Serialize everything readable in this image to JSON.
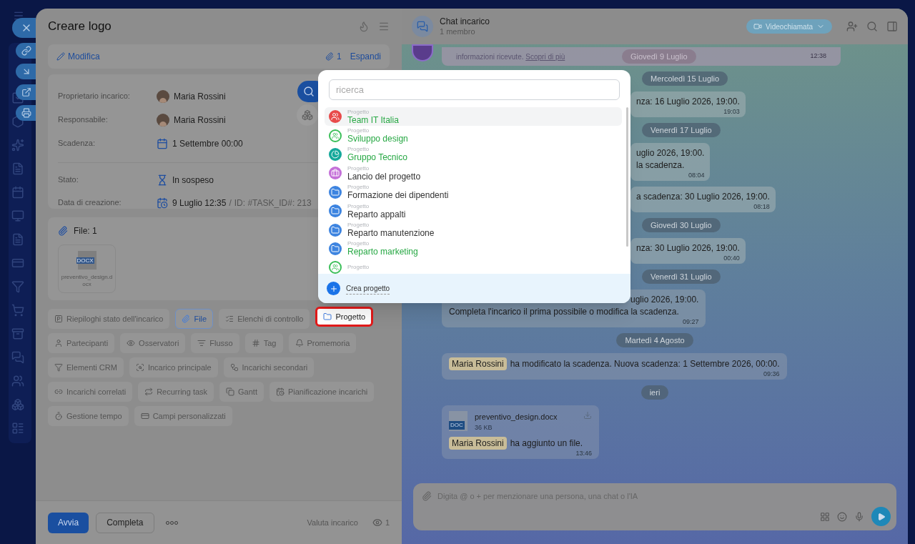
{
  "task": {
    "title": "Creare logo",
    "edit_link": "Modifica",
    "attachments_count": "1",
    "expand_link": "Espandi",
    "fields": [
      {
        "label": "Proprietario incarico:",
        "value": "Maria Rossini",
        "kind": "person"
      },
      {
        "label": "Responsabile:",
        "value": "Maria Rossini",
        "kind": "person"
      },
      {
        "label": "Scadenza:",
        "value": "1 Settembre 00:00",
        "kind": "date"
      },
      {
        "label": "Stato:",
        "value": "In sospeso",
        "kind": "status"
      },
      {
        "label": "Data di creazione:",
        "value": "9 Luglio 12:35",
        "kind": "created",
        "separator": "/",
        "id": "ID: #TASK_ID#: 213"
      }
    ],
    "files_title": "File: 1",
    "file": {
      "name": "preventivo_design.docx",
      "badge": "DOCX"
    },
    "chip_rows": [
      [
        {
          "label": "Riepiloghi stato dell'incarico",
          "selected": false,
          "highlighted": false
        },
        {
          "label": "File",
          "selected": true,
          "highlighted": false
        },
        {
          "label": "Elenchi di controllo",
          "selected": false,
          "highlighted": false
        },
        {
          "label": "Progetto",
          "selected": false,
          "highlighted": true
        }
      ],
      [
        {
          "label": "Partecipanti",
          "selected": false,
          "highlighted": false
        },
        {
          "label": "Osservatori",
          "selected": false,
          "highlighted": false
        },
        {
          "label": "Flusso",
          "selected": false,
          "highlighted": false
        },
        {
          "label": "Tag",
          "selected": false,
          "highlighted": false
        },
        {
          "label": "Promemoria",
          "selected": false,
          "highlighted": false
        }
      ],
      [
        {
          "label": "Elementi CRM",
          "selected": false,
          "highlighted": false
        },
        {
          "label": "Incarico principale",
          "selected": false,
          "highlighted": false
        },
        {
          "label": "Incarichi secondari",
          "selected": false,
          "highlighted": false
        }
      ],
      [
        {
          "label": "Incarichi correlati",
          "selected": false,
          "highlighted": false
        },
        {
          "label": "Recurring task",
          "selected": false,
          "highlighted": false
        },
        {
          "label": "Gantt",
          "selected": false,
          "highlighted": false
        },
        {
          "label": "Pianificazione incarichi",
          "selected": false,
          "highlighted": false
        }
      ],
      [
        {
          "label": "Gestione tempo",
          "selected": false,
          "highlighted": false
        },
        {
          "label": "Campi personalizzati",
          "selected": false,
          "highlighted": false
        }
      ]
    ],
    "footer": {
      "start": "Avvia",
      "complete": "Completa",
      "rate": "Valuta incarico",
      "views": "1"
    }
  },
  "project_menu": {
    "placeholder": "ricerca",
    "items": [
      {
        "kind": "team",
        "color": "#e84a4a",
        "type": "Progetto",
        "name": "Team IT Italia",
        "accent": true,
        "selected": true
      },
      {
        "kind": "hexagon",
        "color": "#3cbf5a",
        "type": "Progetto",
        "name": "Sviluppo design",
        "accent": true,
        "selected": false
      },
      {
        "kind": "pie",
        "color": "#14a89a",
        "type": "Progetto",
        "name": "Gruppo Tecnico",
        "accent": true,
        "selected": false
      },
      {
        "kind": "briefcase",
        "color": "#c470d8",
        "type": "Progetto",
        "name": "Lancio del progetto",
        "accent": false,
        "selected": false
      },
      {
        "kind": "folder",
        "color": "#3d84e0",
        "type": "Progetto",
        "name": "Formazione dei dipendenti",
        "accent": false,
        "selected": false
      },
      {
        "kind": "folder",
        "color": "#3d84e0",
        "type": "Progetto",
        "name": "Reparto appalti",
        "accent": false,
        "selected": false
      },
      {
        "kind": "folder",
        "color": "#3d84e0",
        "type": "Progetto",
        "name": "Reparto manutenzione",
        "accent": false,
        "selected": false
      },
      {
        "kind": "folder",
        "color": "#3d84e0",
        "type": "Progetto",
        "name": "Reparto marketing",
        "accent": true,
        "selected": false
      },
      {
        "kind": "hexagon",
        "color": "#3cbf5a",
        "type": "Progetto",
        "selected": false
      }
    ],
    "create": "Crea progetto"
  },
  "chat": {
    "title": "Chat incarico",
    "members": "1 membro",
    "video_button": "Videochiamata",
    "pinned": {
      "text": "informazioni ricevute.",
      "link": "Scopri di più",
      "time": "12:38",
      "date": "Giovedì 9 Luglio"
    },
    "beside_menu": [
      {
        "kind": "date",
        "text": "Mercoledì 15 Luglio"
      },
      {
        "kind": "message",
        "lines": [
          "nza: 16 Luglio 2026, 19:00."
        ],
        "time": "19:03"
      },
      {
        "kind": "date",
        "text": "Venerdì 17 Luglio"
      },
      {
        "kind": "message",
        "lines": [
          "uglio 2026, 19:00.",
          "la scadenza."
        ],
        "time": "08:04"
      },
      {
        "kind": "message",
        "lines": [
          "a scadenza: 30 Luglio 2026, 19:00."
        ],
        "time": "08:18"
      },
      {
        "kind": "date",
        "text": "Giovedì 30 Luglio"
      },
      {
        "kind": "message",
        "lines": [
          "nza: 30 Luglio 2026, 19:00."
        ],
        "time": "00:40"
      },
      {
        "kind": "date",
        "text": "Venerdì 31 Luglio"
      }
    ],
    "messages": [
      {
        "kind": "message",
        "covered_line": "uglio 2026, 19:00.",
        "lines": [
          "Completa l'incarico il prima possibile o modifica la scadenza."
        ],
        "time": "09:27"
      },
      {
        "kind": "date",
        "text": "Martedì 4 Agosto"
      },
      {
        "kind": "mention",
        "person": "Maria Rossini",
        "text": "ha modificato la scadenza. Nuova scadenza: 1 Settembre 2026, 00:00.",
        "time": "09:36"
      },
      {
        "kind": "date",
        "text": "ieri"
      },
      {
        "kind": "file",
        "file_name": "preventivo_design.docx",
        "size": "36 KB",
        "badge": "DOC",
        "person": "Maria Rossini",
        "text": "ha aggiunto un file.",
        "time": "13:46"
      }
    ],
    "input_placeholder": "Digita @ o + per menzionare una persona, una chat o l'IA"
  }
}
